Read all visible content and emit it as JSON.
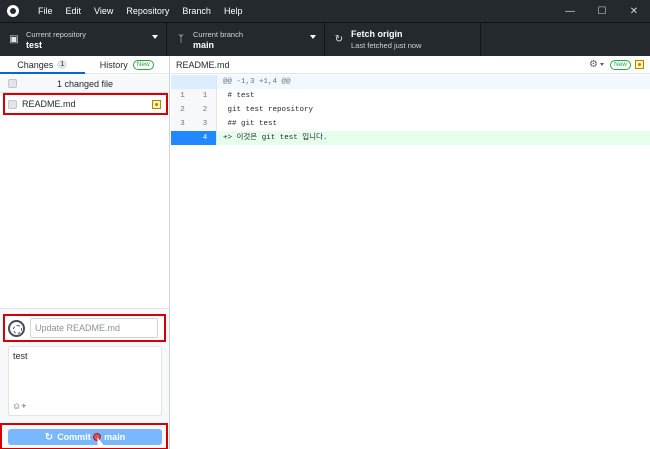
{
  "menu": [
    "File",
    "Edit",
    "View",
    "Repository",
    "Branch",
    "Help"
  ],
  "window_controls": [
    "minimize-icon",
    "maximize-icon",
    "close-icon"
  ],
  "toolbar": {
    "repo_label": "Current repository",
    "repo_value": "test",
    "branch_label": "Current branch",
    "branch_value": "main",
    "fetch_label": "Fetch origin",
    "fetch_sub": "Last fetched just now"
  },
  "tabs": {
    "changes_label": "Changes",
    "changes_count": "1",
    "history_label": "History",
    "history_badge": "New"
  },
  "changes": {
    "count_text": "1 changed file",
    "files": [
      {
        "name": "README.md",
        "status": "modified"
      }
    ]
  },
  "commit": {
    "summary_placeholder": "Update README.md",
    "description": "test",
    "button_label": "Commit to main"
  },
  "diff": {
    "file": "README.md",
    "badge": "New",
    "hunk_header": "@@ -1,3 +1,4 @@",
    "lines": [
      {
        "old": "1",
        "new": "1",
        "text": " # test"
      },
      {
        "old": "2",
        "new": "2",
        "text": " git test repository"
      },
      {
        "old": "3",
        "new": "3",
        "text": " ## git test"
      },
      {
        "old": "",
        "new": "4",
        "text": "+> 이것은 git test 입니다."
      }
    ]
  },
  "colors": {
    "titlebar": "#24292e",
    "accent": "#0366d6",
    "highlight_box": "#d40000",
    "added_bg": "#e6ffed",
    "commit_button": "#79b8ff"
  }
}
